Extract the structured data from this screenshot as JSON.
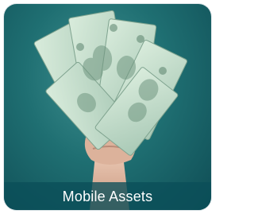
{
  "tile": {
    "caption": "Mobile Assets",
    "image": "fanned-dollar-bills-in-fist"
  },
  "colors": {
    "background": "#1f6f72",
    "caption_bar": "#0a4e58",
    "caption_text": "#ffffff"
  }
}
